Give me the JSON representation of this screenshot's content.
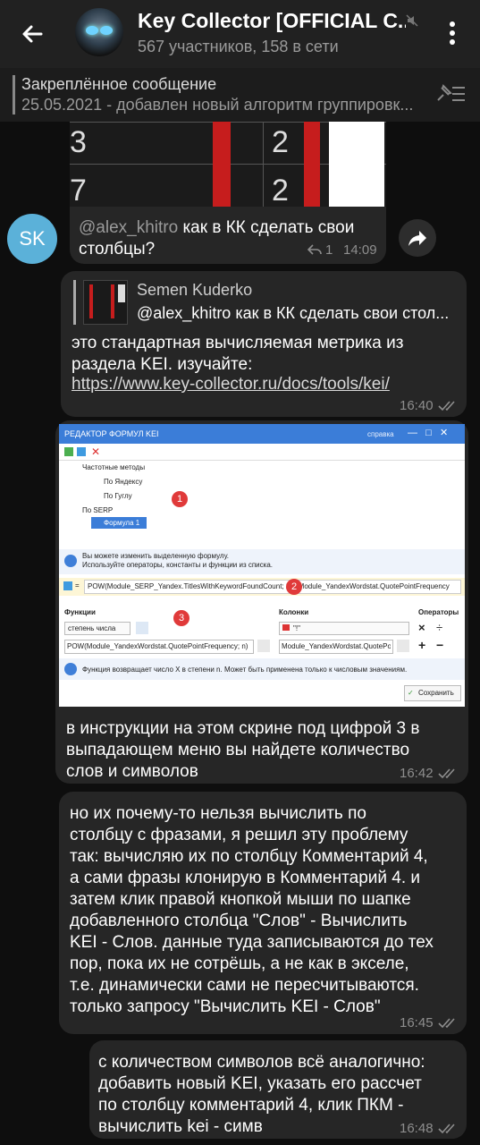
{
  "header": {
    "title": "Key Collector [OFFICIAL C...",
    "subtitle": "567 участников, 158 в сети"
  },
  "pinned": {
    "title": "Закреплённое сообщение",
    "text": "25.05.2021 - добавлен новый алгоритм группировк..."
  },
  "image1": {
    "rows": [
      {
        "left": "3",
        "right": "2"
      },
      {
        "left": "7",
        "right": "2"
      }
    ]
  },
  "msg1": {
    "mention": "@alex_khitro",
    "text_line1": " как в КК сделать свои",
    "text_line2": "столбцы?",
    "replies": "1",
    "time": "14:09"
  },
  "avatar_initials": "SK",
  "msg2": {
    "reply_author": "Semen Kuderko",
    "reply_text": "@alex_khitro как в КК сделать свои стол...",
    "line1": "это стандартная вычисляемая метрика из",
    "line2": "раздела KEI. изучайте:",
    "link": "https://www.key-collector.ru/docs/tools/kei/",
    "time": "16:40"
  },
  "editor": {
    "title": "РЕДАКТОР ФОРМУЛ KEI",
    "help": "справка",
    "tree": [
      "Частотные методы",
      "По Яндексу",
      "По Гуглу",
      "По SERP",
      "Формула 1"
    ],
    "info1": "Вы можете изменить выделенную формулу.",
    "info2": "Используйте операторы, константы и функции из списка.",
    "formula": "POW(Module_SERP_Yandex.TitlesWithKeywordFoundCount; 2) / Module_YandexWordstat.QuotePointFrequency",
    "functions_label": "Функции",
    "functions_select": "степень числа",
    "functions_value": "POW(Module_YandexWordstat.QuotePointFrequency; n)",
    "columns_label": "Колонки",
    "columns_select": "\"!\"",
    "columns_value": "Module_YandexWordstat.QuotePoi",
    "operators_label": "Операторы",
    "ops": [
      "×",
      "÷",
      "+",
      "−"
    ],
    "info3": "Функция возвращает число X в степени n. Может быть применена только к числовым значениям.",
    "save": "Сохранить",
    "markers": [
      "1",
      "2",
      "3"
    ]
  },
  "msg3": {
    "lines": [
      "в инструкции на этом скрине под цифрой 3 в",
      "выпадающем меню вы найдете количество",
      "слов и символов"
    ],
    "time": "16:42"
  },
  "msg4": {
    "lines": [
      "но их почему-то нельзя вычислить по",
      "столбцу с фразами, я решил эту проблему",
      "так: вычисляю их по столбцу Комментарий 4,",
      "а сами фразы клонирую в Комментарий 4. и",
      "затем клик правой кнопкой мыши по шапке",
      "добавленного столбца \"Слов\" - Вычислить",
      "KEI - Слов. данные туда записываются до тех",
      "пор, пока их не сотрёшь, а не как в экселе,",
      "т.е. динамически сами не пересчитываются.",
      "только запросу \"Вычислить KEI - Слов\""
    ],
    "time": "16:45"
  },
  "msg5": {
    "lines": [
      "с количеством символов всё аналогично:",
      "добавить новый KEI, указать его рассчет",
      "по столбцу комментарий 4, клик ПКМ -",
      "вычислить kei - симв"
    ],
    "time": "16:48"
  }
}
